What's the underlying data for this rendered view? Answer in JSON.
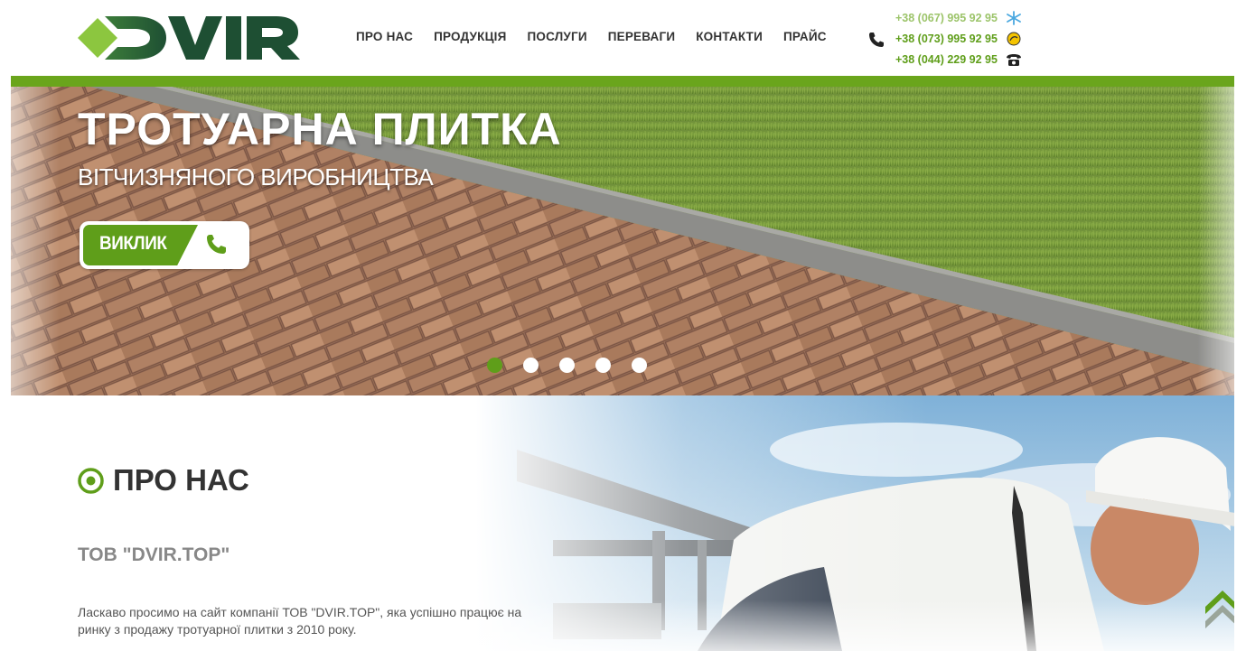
{
  "brand": {
    "logo_text": "DVIR"
  },
  "nav": {
    "items": [
      {
        "label": "ПРО НАС"
      },
      {
        "label": "ПРОДУКЦІЯ"
      },
      {
        "label": "ПОСЛУГИ"
      },
      {
        "label": "ПЕРЕВАГИ"
      },
      {
        "label": "КОНТАКТИ"
      },
      {
        "label": "ПРАЙС"
      }
    ]
  },
  "contacts": {
    "icon": "phone-icon",
    "phones": [
      {
        "number": "+38 (067) 995 92 95",
        "carrier_icon": "kyivstar-icon"
      },
      {
        "number": "+38 (073) 995 92 95",
        "carrier_icon": "lifecell-icon"
      },
      {
        "number": "+38 (044) 229 92 95",
        "carrier_icon": "landline-phone-icon"
      }
    ]
  },
  "hero": {
    "title": "ТРОТУАРНА ПЛИТКА",
    "subtitle": "ВІТЧИЗНЯНОГО ВИРОБНИЦТВА",
    "call_button": "ВИКЛИК",
    "slides_total": 5,
    "active_slide": 1
  },
  "about": {
    "heading": "ПРО НАС",
    "company": "ТОВ \"DVIR.TOP\"",
    "text": "Ласкаво просимо на сайт компанії ТОВ \"DVIR.TOP\", яка успішно працює на ринку з продажу тротуарної плитки з 2010 року."
  },
  "colors": {
    "accent": "#5f9e1a",
    "logo_dark": "#1f5a36",
    "logo_light": "#8cc63f",
    "text_dark": "#333333",
    "text_muted": "#888888"
  }
}
